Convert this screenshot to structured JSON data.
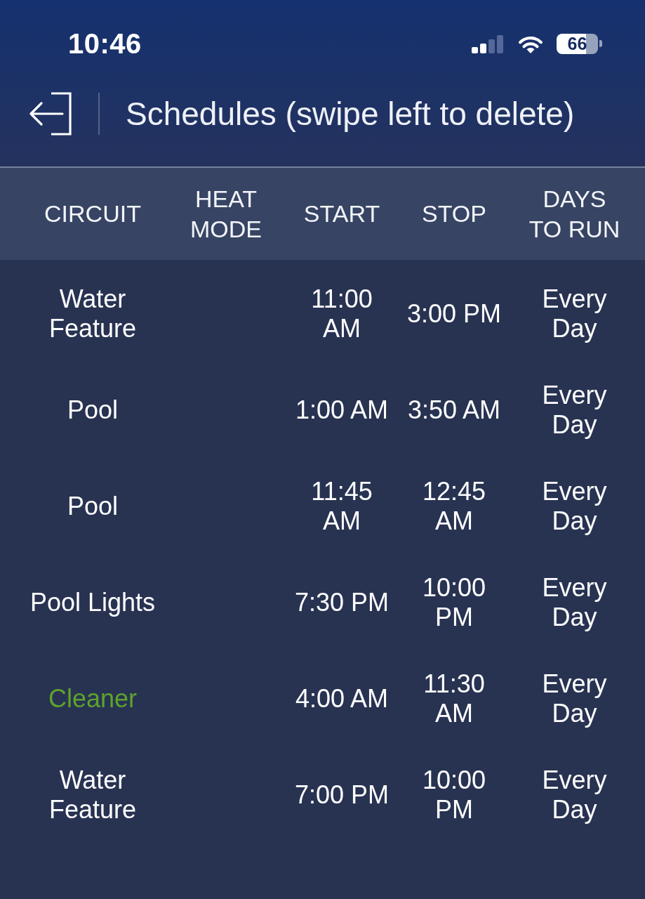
{
  "status_bar": {
    "time": "10:46",
    "battery": "66"
  },
  "nav_bar": {
    "title": "Schedules (swipe left to delete)"
  },
  "table": {
    "columns": [
      "CIRCUIT",
      "HEAT MODE",
      "START",
      "STOP",
      "DAYS TO RUN"
    ],
    "rows": [
      {
        "circuit": "Water Feature",
        "active": false,
        "start": "11:00 AM",
        "stop": "3:00 PM",
        "days": "Every Day"
      },
      {
        "circuit": "Pool",
        "active": false,
        "start": "1:00 AM",
        "stop": "3:50 AM",
        "days": "Every Day"
      },
      {
        "circuit": "Pool",
        "active": false,
        "start": "11:45 AM",
        "stop": "12:45 AM",
        "days": "Every Day"
      },
      {
        "circuit": "Pool Lights",
        "active": false,
        "start": "7:30 PM",
        "stop": "10:00 PM",
        "days": "Every Day"
      },
      {
        "circuit": "Cleaner",
        "active": true,
        "start": "4:00 AM",
        "stop": "11:30 AM",
        "days": "Every Day"
      },
      {
        "circuit": "Water Feature",
        "active": false,
        "start": "7:00 PM",
        "stop": "10:00 PM",
        "days": "Every Day"
      }
    ]
  }
}
